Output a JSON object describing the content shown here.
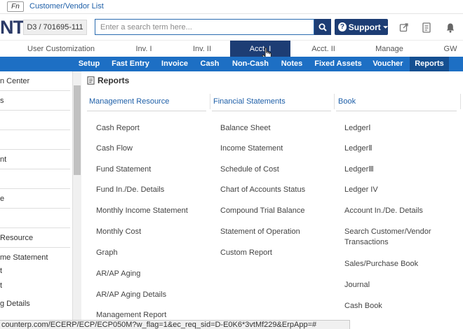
{
  "topbar": {
    "fn_label": "Fn",
    "link": "Customer/Vendor List"
  },
  "header": {
    "logo_text": "NT",
    "company_code": "D3 / 701695-111",
    "search_placeholder": "Enter a search term here...",
    "support_label": "Support",
    "icons": [
      "search-icon",
      "support-icon",
      "export-icon",
      "document-icon",
      "bell-icon"
    ]
  },
  "module_tabs": [
    {
      "label": "User Customization"
    },
    {
      "label": "Inv. I"
    },
    {
      "label": "Inv. II"
    },
    {
      "label": "Acct. I",
      "active": true
    },
    {
      "label": "Acct. II"
    },
    {
      "label": "Manage"
    },
    {
      "label": "GW"
    }
  ],
  "sub_tabs": [
    {
      "label": "Setup"
    },
    {
      "label": "Fast Entry"
    },
    {
      "label": "Invoice"
    },
    {
      "label": "Cash"
    },
    {
      "label": "Non-Cash"
    },
    {
      "label": "Notes"
    },
    {
      "label": "Fixed Assets"
    },
    {
      "label": "Voucher"
    },
    {
      "label": "Reports",
      "active": true
    }
  ],
  "sidebar": {
    "items": [
      {
        "label": "n Center"
      },
      {
        "label": "s"
      },
      {
        "label": ""
      },
      {
        "label": ""
      },
      {
        "label": "nt"
      },
      {
        "label": ""
      },
      {
        "label": "e"
      },
      {
        "label": ""
      },
      {
        "label": "Resource"
      },
      {
        "label": "me Statement"
      },
      {
        "label": "t"
      },
      {
        "label": "t"
      },
      {
        "label": "g Details"
      }
    ]
  },
  "content": {
    "title": "Reports",
    "columns": [
      {
        "header": "Management Resource",
        "items": [
          "Cash Report",
          "Cash Flow",
          "Fund Statement",
          "Fund In./De. Details",
          "Monthly Income Statement",
          "Monthly Cost",
          "Graph",
          "AR/AP Aging",
          "AR/AP Aging Details",
          "Management Report"
        ]
      },
      {
        "header": "Financial Statements",
        "items": [
          "Balance Sheet",
          "Income Statement",
          "Schedule of Cost",
          "Chart of Accounts Status",
          "Compound Trial Balance",
          "Statement of Operation",
          "Custom Report"
        ]
      },
      {
        "header": "Book",
        "items": [
          "LedgerⅠ",
          "LedgerⅡ",
          "LedgerⅢ",
          "Ledger IV",
          "Account In./De. Details",
          "Search Customer/Vendor Transactions",
          "Sales/Purchase Book",
          "Journal",
          "Cash Book"
        ]
      }
    ]
  },
  "statusbar": {
    "url": "counterp.com/ECERP/ECP/ECP050M?w_flag=1&ec_req_sid=D-E0K6*3vtMf229&ErpApp=#"
  }
}
